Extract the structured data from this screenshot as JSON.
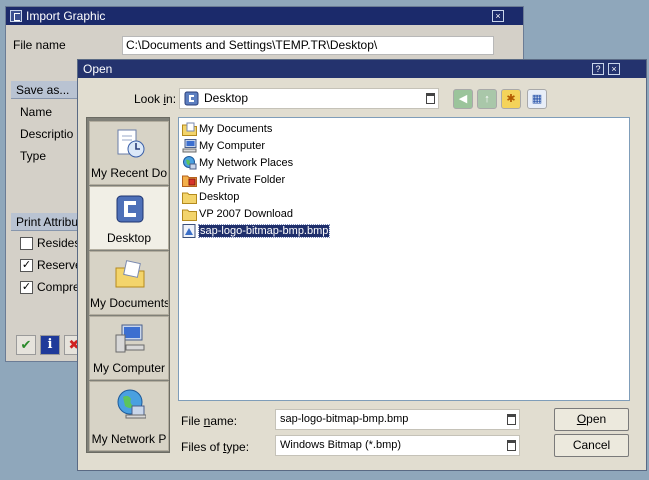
{
  "import_window": {
    "title": "Import Graphic",
    "close_glyph": "×",
    "file_name_label": "File name",
    "file_name_value": "C:\\Documents and Settings\\TEMP.TR\\Desktop\\",
    "save_as_label": "Save as...",
    "name_label": "Name",
    "description_label": "Descriptio",
    "type_label": "Type",
    "print_attributes_label": "Print Attribu",
    "checkboxes": [
      {
        "label": "Resides",
        "checked": false,
        "mark": ""
      },
      {
        "label": "Reserve",
        "checked": true,
        "mark": "✓"
      },
      {
        "label": "Compre",
        "checked": true,
        "mark": "✓"
      }
    ],
    "toolbar": {
      "ok_glyph": "✔",
      "info_glyph": "i",
      "cancel_glyph": "✖"
    }
  },
  "open_dialog": {
    "title": "Open",
    "help_glyph": "?",
    "close_glyph": "×",
    "look_in_label_pre": "Look ",
    "look_in_label_key": "i",
    "look_in_label_post": "n:",
    "look_in_value": "Desktop",
    "nav": {
      "back_glyph": "◀",
      "up_glyph": "↑",
      "new_folder_glyph": "✱",
      "view_glyph": "▦"
    },
    "places": [
      {
        "label": "My Recent Do",
        "icon": "recent-documents-icon"
      },
      {
        "label": "Desktop",
        "icon": "desktop-icon"
      },
      {
        "label": "My Documents",
        "icon": "my-documents-icon"
      },
      {
        "label": "My Computer",
        "icon": "my-computer-icon"
      },
      {
        "label": "My Network P",
        "icon": "network-places-icon"
      }
    ],
    "files": [
      {
        "name": "My Documents",
        "icon": "my-documents-folder-icon",
        "selected": false
      },
      {
        "name": "My Computer",
        "icon": "my-computer-icon",
        "selected": false
      },
      {
        "name": "My Network Places",
        "icon": "network-places-icon",
        "selected": false
      },
      {
        "name": "My Private Folder",
        "icon": "private-folder-icon",
        "selected": false
      },
      {
        "name": "Desktop",
        "icon": "folder-icon",
        "selected": false
      },
      {
        "name": "VP 2007 Download",
        "icon": "folder-icon",
        "selected": false
      },
      {
        "name": "sap-logo-bitmap-bmp.bmp",
        "icon": "bitmap-file-icon",
        "selected": true
      }
    ],
    "file_name_label_pre": "File ",
    "file_name_label_key": "n",
    "file_name_label_post": "ame:",
    "file_name_value": "sap-logo-bitmap-bmp.bmp",
    "file_type_label_pre": "Files of ",
    "file_type_label_key": "t",
    "file_type_label_post": "ype:",
    "file_type_value": "Windows Bitmap (*.bmp)",
    "open_button_key": "O",
    "open_button_rest": "pen",
    "cancel_button_label": "Cancel"
  },
  "colors": {
    "titlebar": "#1b2a6b",
    "selection": "#1f2f6b",
    "dialog_bg": "#e1ddd0",
    "window_bg": "#d4d0c8"
  }
}
